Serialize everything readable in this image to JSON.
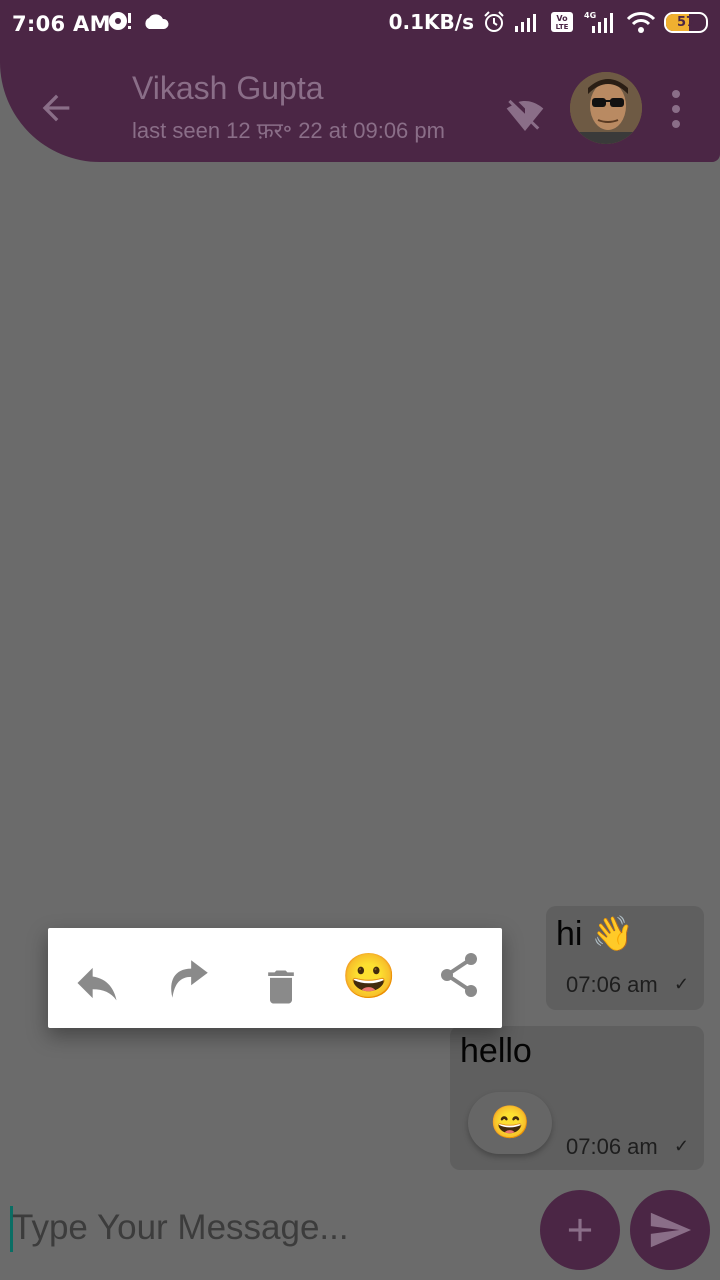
{
  "status_bar": {
    "time": "7:06 AM",
    "speed": "0.1KB/s",
    "battery": "57",
    "battery_level": 0.57,
    "network_label": "4G",
    "volte_label": "Vo LTE"
  },
  "header": {
    "title": "Vikash Gupta",
    "subtitle": "last seen 12 फ़र॰ 22 at 09:06 pm"
  },
  "messages": [
    {
      "text": "hi 👋",
      "time": "07:06 am",
      "status": "✓"
    },
    {
      "text": "hello",
      "time": "07:06 am",
      "status": "✓",
      "reaction": "😄"
    }
  ],
  "popup": {
    "emoji": "😀"
  },
  "composer": {
    "placeholder": "Type Your Message..."
  },
  "colors": {
    "brand": "#4b2645",
    "overlay_bg": "#6b6b6b",
    "popup_bg": "#ffffff"
  },
  "icons": [
    "arrow-back-icon",
    "wifi-off-icon",
    "more-vert-icon",
    "reply-icon",
    "forward-icon",
    "delete-icon",
    "emoji-icon",
    "share-icon",
    "add-icon",
    "send-icon",
    "alarm-icon",
    "cloud-icon",
    "signal-icon",
    "wifi-icon",
    "battery-icon"
  ]
}
